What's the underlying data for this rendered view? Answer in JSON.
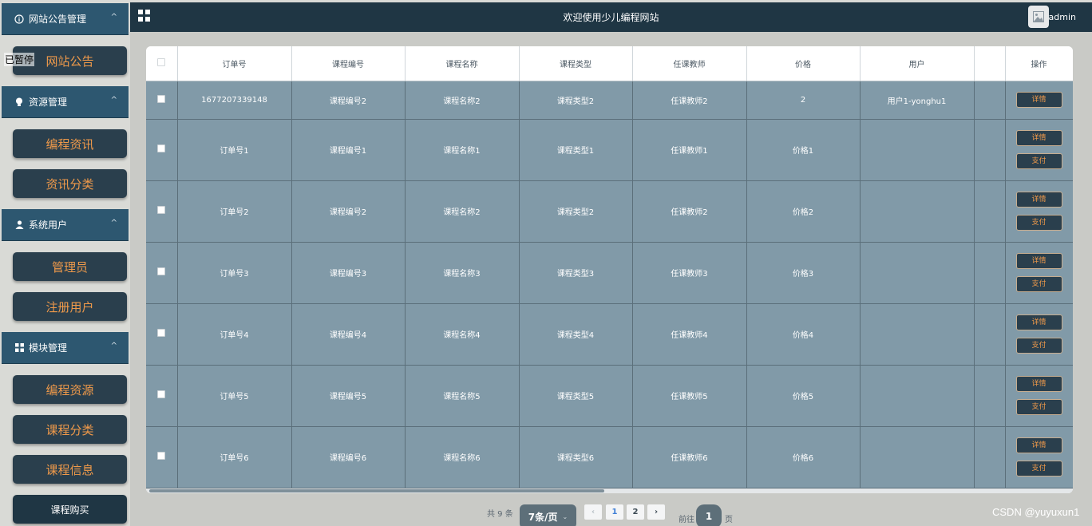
{
  "sidebar": {
    "paused_label": "已暂停",
    "groups": [
      {
        "title": "网站公告管理",
        "icon": "info-circle-icon",
        "items": [
          "网站公告"
        ]
      },
      {
        "title": "资源管理",
        "icon": "bulb-icon",
        "items": [
          "编程资讯",
          "资讯分类"
        ]
      },
      {
        "title": "系统用户",
        "icon": "user-icon",
        "items": [
          "管理员",
          "注册用户"
        ]
      },
      {
        "title": "模块管理",
        "icon": "grid-icon",
        "items": [
          "编程资源",
          "课程分类",
          "课程信息",
          "课程购买"
        ]
      }
    ]
  },
  "header": {
    "title": "欢迎使用少儿编程网站",
    "user": "admin"
  },
  "table": {
    "columns": [
      "订单号",
      "课程编号",
      "课程名称",
      "课程类型",
      "任课教师",
      "价格",
      "用户",
      "",
      "操作"
    ],
    "rows": [
      {
        "order_no": "1677207339148",
        "course_no": "课程编号2",
        "course_name": "课程名称2",
        "course_type": "课程类型2",
        "teacher": "任课教师2",
        "price": "2",
        "user": "用户1-yonghu1",
        "actions": [
          "详情"
        ]
      },
      {
        "order_no": "订单号1",
        "course_no": "课程编号1",
        "course_name": "课程名称1",
        "course_type": "课程类型1",
        "teacher": "任课教师1",
        "price": "价格1",
        "user": "",
        "actions": [
          "详情",
          "支付"
        ]
      },
      {
        "order_no": "订单号2",
        "course_no": "课程编号2",
        "course_name": "课程名称2",
        "course_type": "课程类型2",
        "teacher": "任课教师2",
        "price": "价格2",
        "user": "",
        "actions": [
          "详情",
          "支付"
        ]
      },
      {
        "order_no": "订单号3",
        "course_no": "课程编号3",
        "course_name": "课程名称3",
        "course_type": "课程类型3",
        "teacher": "任课教师3",
        "price": "价格3",
        "user": "",
        "actions": [
          "详情",
          "支付"
        ]
      },
      {
        "order_no": "订单号4",
        "course_no": "课程编号4",
        "course_name": "课程名称4",
        "course_type": "课程类型4",
        "teacher": "任课教师4",
        "price": "价格4",
        "user": "",
        "actions": [
          "详情",
          "支付"
        ]
      },
      {
        "order_no": "订单号5",
        "course_no": "课程编号5",
        "course_name": "课程名称5",
        "course_type": "课程类型5",
        "teacher": "任课教师5",
        "price": "价格5",
        "user": "",
        "actions": [
          "详情",
          "支付"
        ]
      },
      {
        "order_no": "订单号6",
        "course_no": "课程编号6",
        "course_name": "课程名称6",
        "course_type": "课程类型6",
        "teacher": "任课教师6",
        "price": "价格6",
        "user": "",
        "actions": [
          "详情",
          "支付"
        ]
      }
    ]
  },
  "pagination": {
    "total": "共 9 条",
    "page_size": "7条/页",
    "prev": "‹",
    "pages": [
      "1",
      "2"
    ],
    "current": "1",
    "next": "›",
    "goto_label": "前往",
    "goto_value": "1",
    "goto_suffix": "页"
  },
  "watermark": "CSDN @yuyuxun1",
  "colors": {
    "sidebar_header": "#2d5770",
    "menu_item_bg": "#2a3f4d",
    "menu_text": "#f09a4a",
    "topbar": "#1f3644",
    "table_row": "#819aa8"
  }
}
